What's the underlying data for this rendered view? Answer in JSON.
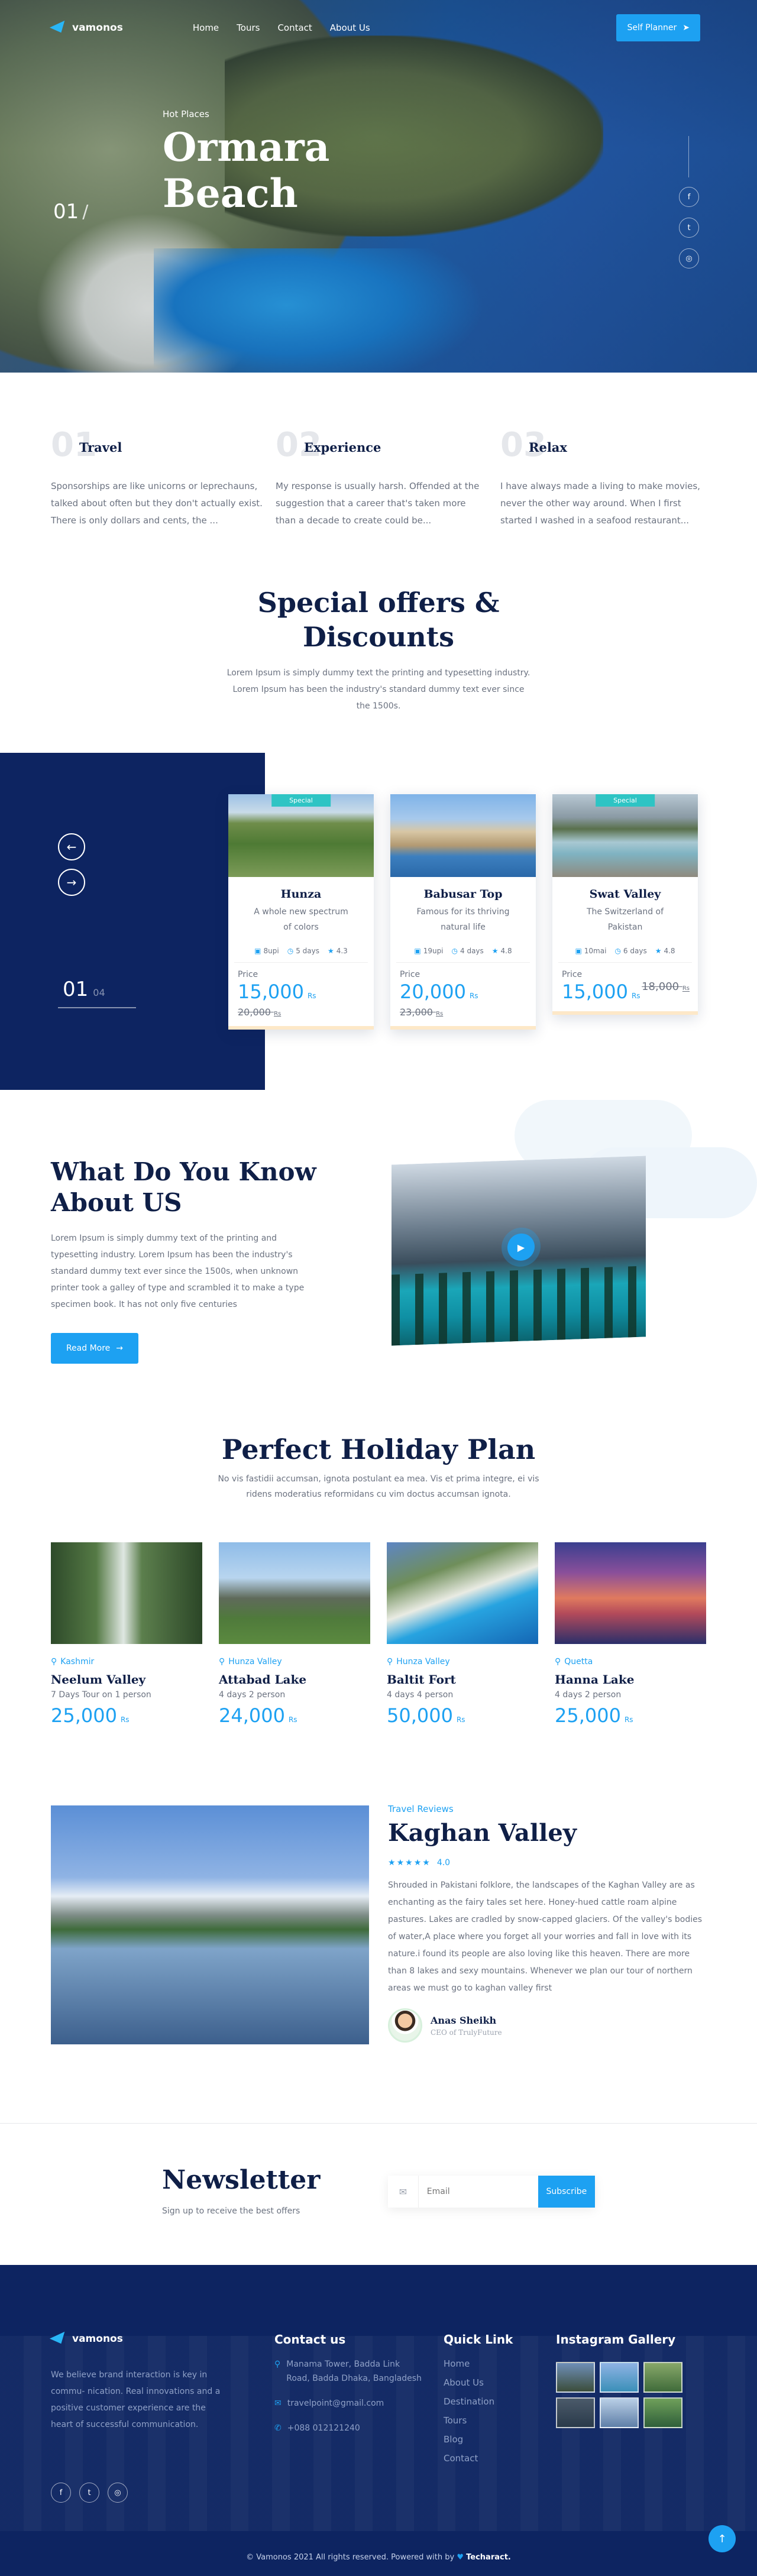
{
  "nav": {
    "brand": "vamonos",
    "links": [
      "Home",
      "Tours",
      "Contact",
      "About Us"
    ],
    "cta": "Self Planner"
  },
  "hero": {
    "kicker": "Hot Places",
    "title_line1": "Ormara",
    "title_line2": "Beach",
    "slide": "01",
    "slash": "/"
  },
  "features": [
    {
      "num": "01",
      "title": "Travel",
      "desc": "Sponsorships are like unicorns or leprechauns, talked about often but they don't actually exist. There is only dollars and cents, the ..."
    },
    {
      "num": "02",
      "title": "Experience",
      "desc": "My response is usually harsh. Offended at the suggestion that a career that's taken more than a decade to create could be..."
    },
    {
      "num": "03",
      "title": "Relax",
      "desc": "I have always made a living to make movies, never the other way around. When I first started I washed in a seafood restaurant..."
    }
  ],
  "special": {
    "title": "Special offers & Discounts",
    "desc": "Lorem Ipsum is simply dummy text the printing and typesetting industry. Lorem Ipsum has been the industry's standard dummy text ever since the 1500s."
  },
  "offers": {
    "counter_current": "01",
    "counter_total": "04",
    "price_label": "Price",
    "currency": "Rs",
    "cards": [
      {
        "badge": "Special",
        "title": "Hunza",
        "subtitle": "A whole new spectrum of colors",
        "size": "8upi",
        "days": "5 days",
        "rating": "4.3",
        "price": "15,000",
        "old_price": "20,000"
      },
      {
        "badge": "",
        "title": "Babusar Top",
        "subtitle": "Famous for its thriving natural life",
        "size": "19upi",
        "days": "4 days",
        "rating": "4.8",
        "price": "20,000",
        "old_price": "23,000"
      },
      {
        "badge": "Special",
        "title": "Swat Valley",
        "subtitle": "The Switzerland of Pakistan",
        "size": "10mai",
        "days": "6 days",
        "rating": "4.8",
        "price": "15,000",
        "old_price": "18,000"
      }
    ]
  },
  "what": {
    "title_line1": "What Do You Know",
    "title_line2": "About US",
    "desc": "Lorem Ipsum is simply dummy text of the printing and typesetting industry. Lorem Ipsum has been the industry's standard dummy text ever since the 1500s, when unknown printer took a galley of type and scrambled it to make a type specimen book. It has not only five centuries",
    "button": "Read More"
  },
  "holiday": {
    "title": "Perfect Holiday Plan",
    "desc": "No vis fastidii accumsan, ignota postulant ea mea. Vis et prima integre, ei vis ridens moderatius reformidans cu vim doctus accumsan ignota.",
    "currency": "Rs",
    "items": [
      {
        "location": "Kashmir",
        "title": "Neelum Valley",
        "sub": "7 Days Tour on 1 person",
        "price": "25,000"
      },
      {
        "location": "Hunza Valley",
        "title": "Attabad Lake",
        "sub": "4 days 2 person",
        "price": "24,000"
      },
      {
        "location": "Hunza Valley",
        "title": "Baltit Fort",
        "sub": "4 days 4 person",
        "price": "50,000"
      },
      {
        "location": "Quetta",
        "title": "Hanna Lake",
        "sub": "4 days 2 person",
        "price": "25,000"
      }
    ]
  },
  "review": {
    "kicker": "Travel Reviews",
    "title": "Kaghan Valley",
    "rating": "4.0",
    "text": "Shrouded in Pakistani folklore, the landscapes of the Kaghan Valley are as enchanting as the fairy tales set here. Honey-hued cattle roam alpine pastures. Lakes are cradled by snow-capped glaciers. Of the valley's bodies of water,A place where you forget all your worries and fall in love with its nature.i found its people are also loving like this heaven. There are more than 8 lakes and sexy mountains. Whenever we plan our tour of northern areas we must go to kaghan valley first",
    "author_name": "Anas Sheikh",
    "author_role": "CEO of TrulyFuture"
  },
  "newsletter": {
    "title": "Newsletter",
    "subtitle": "Sign up to receive the best offers",
    "placeholder": "Email",
    "button": "Subscribe"
  },
  "footer": {
    "brand": "vamonos",
    "about": "We believe brand interaction is key in commu- nication. Real innovations and a positive customer experience are the heart of successful communication.",
    "contact_title": "Contact us",
    "address": "Manama Tower, Badda Link Road, Badda Dhaka, Bangladesh",
    "email": "travelpoint@gmail.com",
    "phone": "+088 012121240",
    "quick_title": "Quick Link",
    "quick_links": [
      "Home",
      "About Us",
      "Destination",
      "Tours",
      "Blog",
      "Contact"
    ],
    "gallery_title": "Instagram Gallery",
    "copyright": "© Vamonos 2021 All rights reserved. Powered with by",
    "powered_by": "Techaract."
  },
  "colors": {
    "accent": "#1da1f2",
    "navy": "#0d2461",
    "heading": "#0f1f47",
    "teal_badge": "#2ec4c4"
  }
}
